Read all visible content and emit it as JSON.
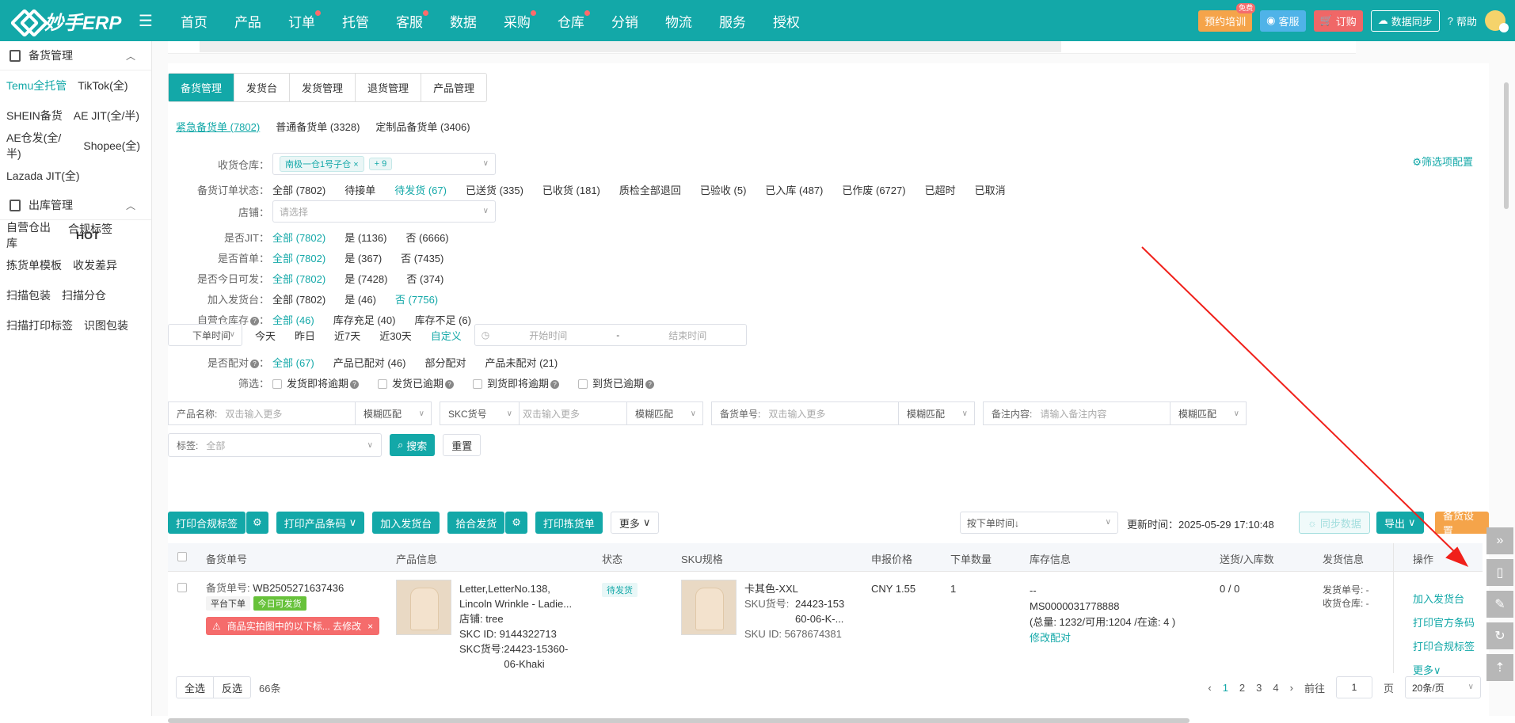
{
  "topbar": {
    "brand": "妙手ERP",
    "nav": [
      {
        "label": "首页",
        "dot": false
      },
      {
        "label": "产品",
        "dot": false
      },
      {
        "label": "订单",
        "dot": true
      },
      {
        "label": "托管",
        "dot": false
      },
      {
        "label": "客服",
        "dot": true
      },
      {
        "label": "数据",
        "dot": false
      },
      {
        "label": "采购",
        "dot": true
      },
      {
        "label": "仓库",
        "dot": true
      },
      {
        "label": "分销",
        "dot": false
      },
      {
        "label": "物流",
        "dot": false
      },
      {
        "label": "服务",
        "dot": false
      },
      {
        "label": "授权",
        "dot": false
      }
    ],
    "training": "预约培训",
    "training_badge": "免费",
    "service": "客服",
    "subscribe": "订购",
    "sync": "数据同步",
    "help": "帮助"
  },
  "sidebar": {
    "group1": "备货管理",
    "group1_items": [
      [
        "Temu全托管",
        "TikTok(全)"
      ],
      [
        "SHEIN备货",
        "AE JIT(全/半)"
      ],
      [
        "AE仓发(全/半)",
        "Shopee(全)"
      ],
      [
        "Lazada JIT(全)"
      ]
    ],
    "group2": "出库管理",
    "group2_items": [
      [
        "自营仓出库",
        "合规标签"
      ],
      [
        "拣货单模板",
        "收发差异"
      ],
      [
        "扫描包装",
        "扫描分仓"
      ],
      [
        "扫描打印标签",
        "识图包装"
      ]
    ],
    "hot": "HOT"
  },
  "tabs": [
    "备货管理",
    "发货台",
    "发货管理",
    "退货管理",
    "产品管理"
  ],
  "subtabs": [
    "紧急备货单 (7802)",
    "普通备货单 (3328)",
    "定制品备货单 (3406)"
  ],
  "filter_config": "筛选项配置",
  "filters": {
    "warehouse_label": "收货仓库：",
    "warehouse_tag": "南极一仓1号子仓",
    "warehouse_more": "+ 9",
    "status_label": "备货订单状态：",
    "status_opts": [
      "全部 (7802)",
      "待接单",
      "待发货 (67)",
      "已送货 (335)",
      "已收货 (181)",
      "质检全部退回",
      "已验收 (5)",
      "已入库 (487)",
      "已作废 (6727)",
      "已超时",
      "已取消"
    ],
    "shop_label": "店铺：",
    "shop_placeholder": "请选择",
    "jit_label": "是否JIT：",
    "jit_opts": [
      "全部 (7802)",
      "是 (1136)",
      "否 (6666)"
    ],
    "first_label": "是否首单：",
    "first_opts": [
      "全部 (7802)",
      "是 (367)",
      "否 (7435)"
    ],
    "today_label": "是否今日可发：",
    "today_opts": [
      "全部 (7802)",
      "是 (7428)",
      "否 (374)"
    ],
    "desk_label": "加入发货台：",
    "desk_opts": [
      "全部 (7802)",
      "是 (46)",
      "否 (7756)"
    ],
    "stock_label": "自营仓库存",
    "stock_opts": [
      "全部 (46)",
      "库存充足 (40)",
      "库存不足 (6)"
    ],
    "time_select": "下单时间",
    "time_opts": [
      "今天",
      "昨日",
      "近7天",
      "近30天",
      "自定义"
    ],
    "start_time": "开始时间",
    "time_sep": "-",
    "end_time": "结束时间",
    "match_label": "是否配对",
    "match_opts": [
      "全部 (67)",
      "产品已配对 (46)",
      "部分配对",
      "产品未配对 (21)"
    ],
    "filter_label": "筛选：",
    "filter_checks": [
      "发货即将逾期",
      "发货已逾期",
      "到货即将逾期",
      "到货已逾期"
    ]
  },
  "search": {
    "product_label": "产品名称:",
    "product_ph": "双击输入更多",
    "match_mode": "模糊匹配",
    "skc_select": "SKC货号",
    "skc_ph": "双击输入更多",
    "order_label": "备货单号:",
    "order_ph": "双击输入更多",
    "remark_label": "备注内容:",
    "remark_ph": "请输入备注内容",
    "tag_label": "标签:",
    "tag_value": "全部",
    "search_btn": "搜索",
    "reset_btn": "重置"
  },
  "actions": {
    "print_label": "打印合规标签",
    "print_barcode": "打印产品条码",
    "add_desk": "加入发货台",
    "merge_ship": "拾合发货",
    "print_pick": "打印拣货单",
    "more": "更多",
    "sort": "按下单时间↓",
    "update_time": "更新时间：2025-05-29 17:10:48",
    "sync": "同步数据",
    "export": "导出",
    "settings": "备货设置"
  },
  "table": {
    "headers": [
      "备货单号",
      "产品信息",
      "状态",
      "SKU规格",
      "申报价格",
      "下单数量",
      "库存信息",
      "送货/入库数",
      "发货信息",
      "操作"
    ],
    "row": {
      "order_label": "备货单号:",
      "order_no": "WB2505271637436",
      "platform": "平台下单",
      "today_ship": "今日可发货",
      "warning": "商品实拍图中的以下标... 去修改",
      "product_name1": "Letter,LetterNo.138,",
      "product_name2": "Lincoln Wrinkle - Ladie...",
      "shop": "店铺:  tree",
      "skc_id": "SKC ID:  9144322713",
      "skc_no_label": "SKC货号:",
      "skc_no1": "24423-15360-",
      "skc_no2": "06-Khaki",
      "status": "待发货",
      "sku_name": "卡其色-XXL",
      "sku_no_label": "SKU货号:",
      "sku_no1": "24423-153",
      "sku_no2": "60-06-K-...",
      "sku_id": "SKU ID:  5678674381",
      "price": "CNY 1.55",
      "qty": "1",
      "stock1": "--",
      "stock2": "MS0000031778888",
      "stock3": "(总量: 1232/可用:1204 /在途: 4 )",
      "stock_edit": "修改配对",
      "delivered": "0 / 0",
      "ship_no": "发货单号: -",
      "ship_wh": "收货仓库: -",
      "ops": [
        "加入发货台",
        "打印官方条码",
        "打印合规标签",
        "更多"
      ]
    }
  },
  "footer": {
    "select_all": "全选",
    "invert": "反选",
    "count": "66条",
    "pages": [
      "1",
      "2",
      "3",
      "4"
    ],
    "goto": "前往",
    "page_value": "1",
    "page_unit": "页",
    "per_page": "20条/页"
  }
}
